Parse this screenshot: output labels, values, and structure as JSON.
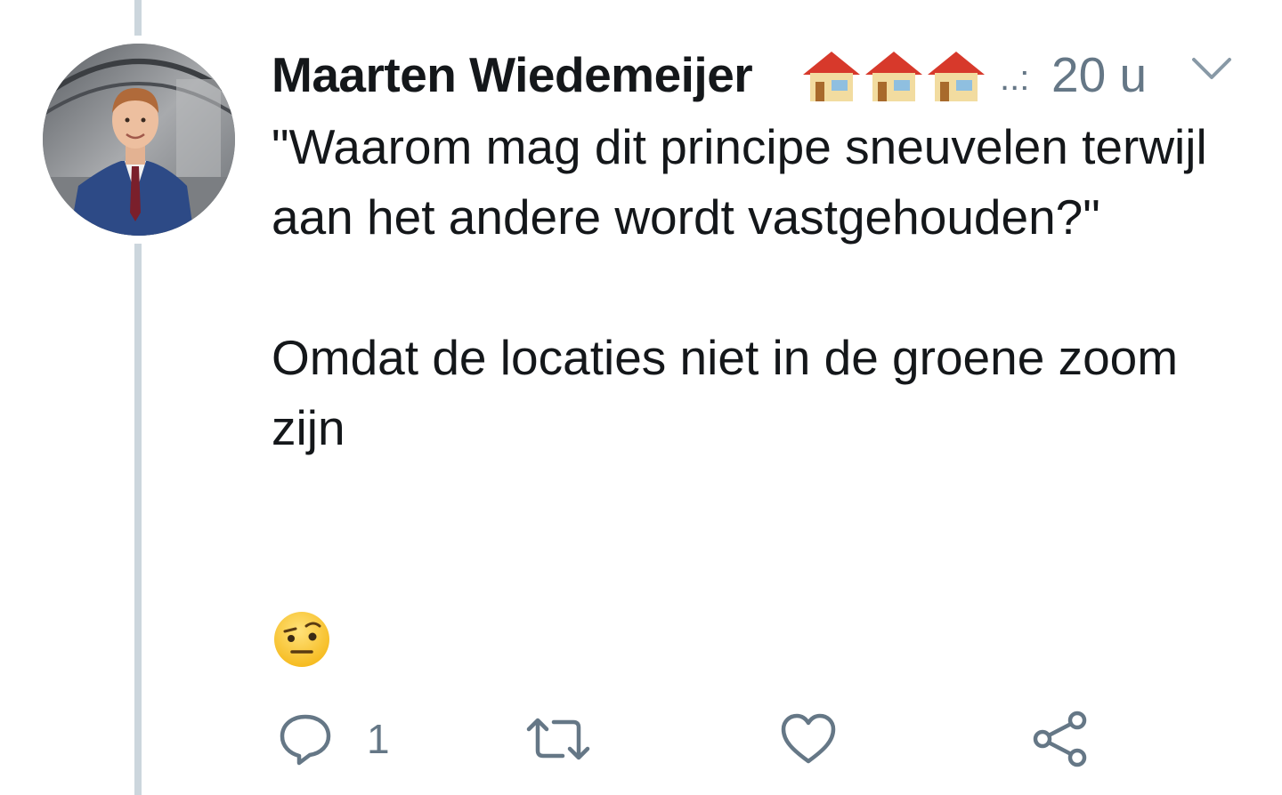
{
  "tweet": {
    "author_name": "Maarten Wiedemeijer",
    "name_emoji": "houses-emoji",
    "name_suffix": "..:",
    "time": "20 u",
    "body_paragraphs": [
      "\"Waarom mag dit principe sneuvelen terwijl aan het andere wordt vastgehouden?\"",
      "Omdat de locaties niet in de groene zoom zijn"
    ],
    "trailing_emoji": "face-with-raised-eyebrow-emoji",
    "actions": {
      "reply_count": "1"
    }
  },
  "colors": {
    "text": "#14171a",
    "secondary": "#657786",
    "thread_line": "#ccd6dd"
  },
  "icons": [
    "chevron-down-icon",
    "reply-icon",
    "retweet-icon",
    "like-icon",
    "share-icon"
  ]
}
